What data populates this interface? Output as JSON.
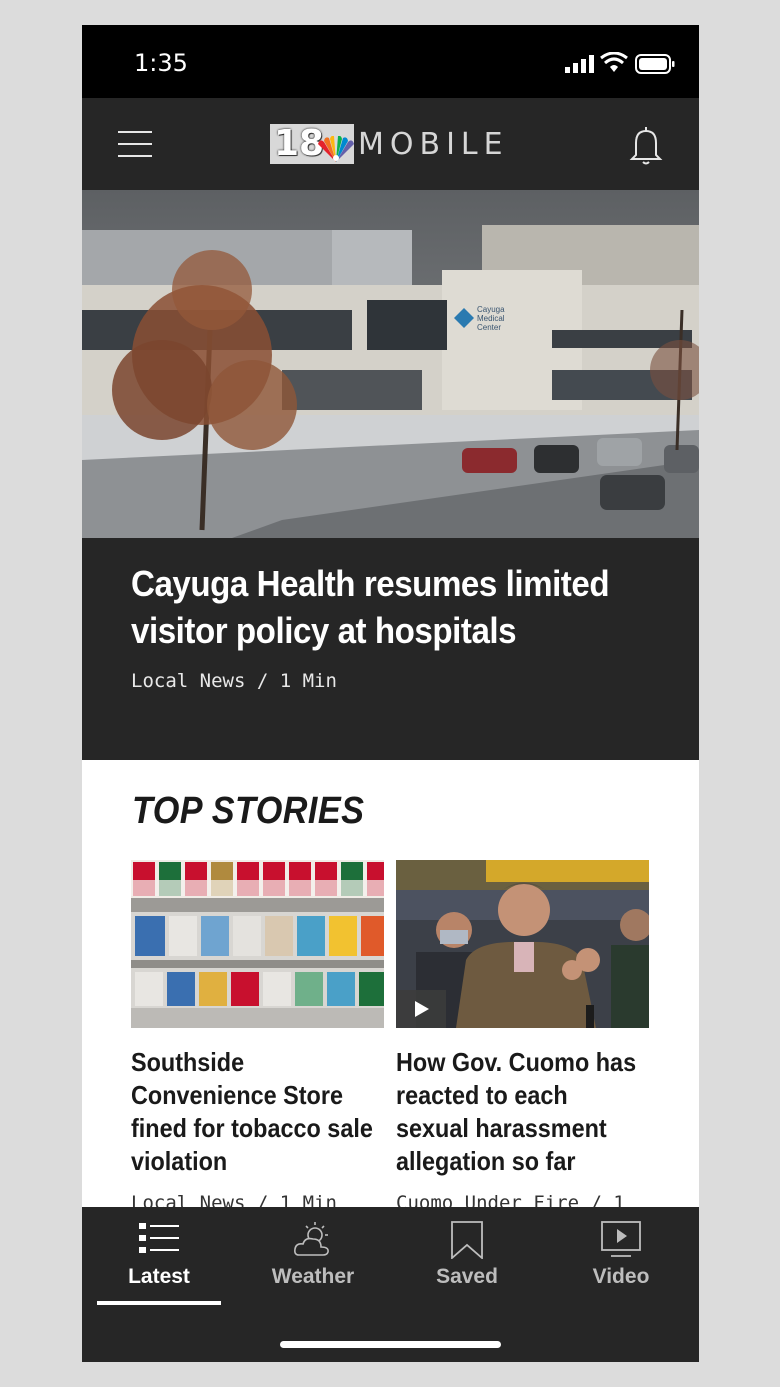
{
  "status_bar": {
    "time": "1:35"
  },
  "header": {
    "logo_number": "18",
    "logo_word": "MOBILE",
    "menu_icon": "hamburger-menu-icon",
    "notification_icon": "bell-icon"
  },
  "hero": {
    "image_alt": "Cayuga Medical Center building in winter",
    "sign_text": "Cayuga Medical Center",
    "title": "Cayuga Health resumes limited visitor policy at hospitals",
    "meta": "Local News / 1 Min"
  },
  "top_stories": {
    "heading": "TOP STORIES",
    "items": [
      {
        "title": "Southside Convenience Store fined for tobacco sale violation",
        "meta": "Local News / 1 Min",
        "has_video": false
      },
      {
        "title": "How Gov. Cuomo has reacted to each sexual harassment allegation so far",
        "meta": "Cuomo Under Fire / 1",
        "has_video": true
      }
    ]
  },
  "tab_bar": {
    "tabs": [
      {
        "label": "Latest",
        "icon": "list-icon",
        "active": true
      },
      {
        "label": "Weather",
        "icon": "weather-icon",
        "active": false
      },
      {
        "label": "Saved",
        "icon": "bookmark-icon",
        "active": false
      },
      {
        "label": "Video",
        "icon": "video-play-icon",
        "active": false
      }
    ]
  },
  "colors": {
    "bar_bg": "#262626",
    "status_bg": "#000000",
    "text_dark": "#1a1a1a"
  }
}
